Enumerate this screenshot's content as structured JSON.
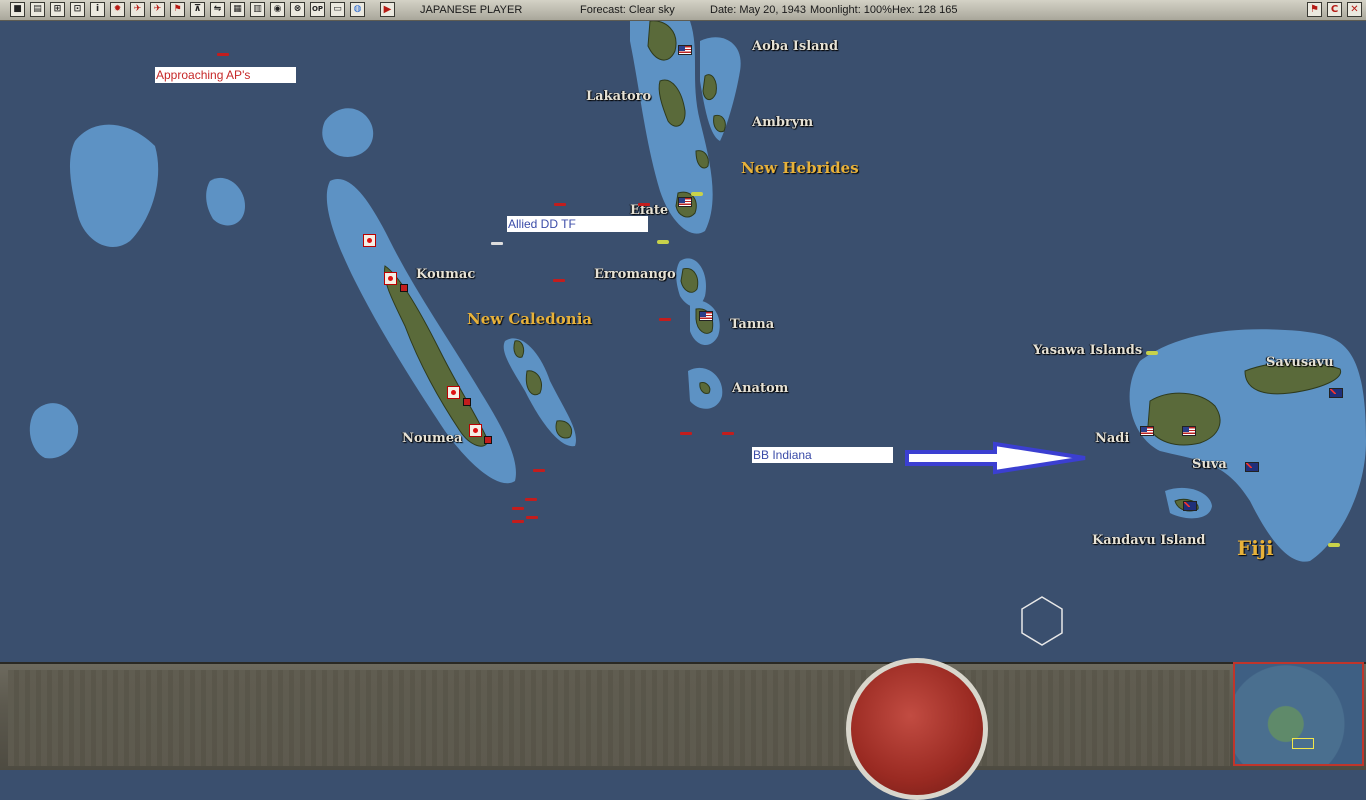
{
  "toolbar": {
    "buttons": [
      "■",
      "▤",
      "⊞",
      "⊡",
      "i",
      "✹",
      "✈",
      "✈",
      "⚑",
      "⊼",
      "⇋",
      "▦",
      "▥",
      "◉",
      "⊗",
      "OP",
      "▭",
      "◍"
    ],
    "play": "▶",
    "player": "JAPANESE PLAYER",
    "forecast": "Forecast: Clear sky",
    "date": "Date: May 20, 1943",
    "moonlight": "Moonlight: 100%",
    "hex": "Hex: 128 165",
    "right_buttons": [
      "⚑",
      "C",
      "✕"
    ]
  },
  "map": {
    "places": {
      "aoba_island": "Aoba Island",
      "lakatoro": "Lakatoro",
      "ambrym": "Ambrym",
      "efate": "Efate",
      "koumac": "Koumac",
      "erromango": "Erromango",
      "tanna": "Tanna",
      "anatom": "Anatom",
      "noumea": "Noumea",
      "yasawa": "Yasawa Islands",
      "savusavu": "Savusavu",
      "nadi": "Nadi",
      "suva": "Suva",
      "kandavu": "Kandavu Island"
    },
    "regions": {
      "new_hebrides": "New Hebrides",
      "new_caledonia": "New Caledonia",
      "fiji": "Fiji"
    },
    "annotations": {
      "approaching": "Approaching AP's",
      "allied_dd": "Allied DD TF",
      "bb_indiana": "BB Indiana"
    },
    "colors": {
      "sea": "#3a4f6e",
      "shallow": "#5d92c4",
      "land": "#5a6a3a",
      "annotation_red": "#c62828",
      "annotation_blue": "#3b4ca8",
      "arrow": "#3b3fd1"
    }
  }
}
